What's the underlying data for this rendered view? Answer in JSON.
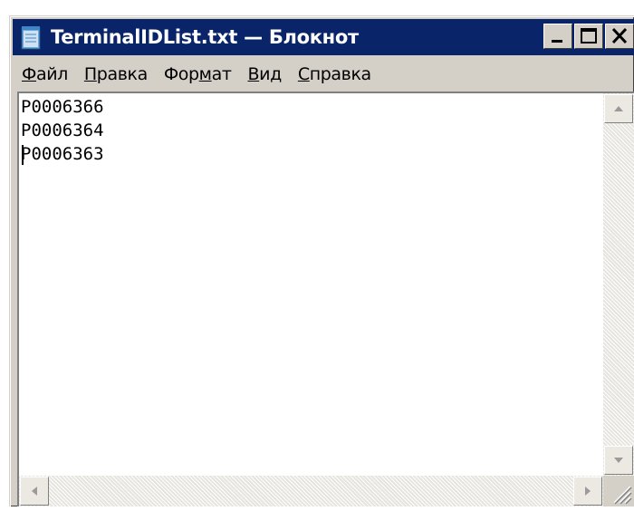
{
  "window": {
    "title": "TerminalIDList.txt — Блокнот"
  },
  "menu": {
    "file": {
      "accel": "Ф",
      "rest": "айл"
    },
    "edit": {
      "accel": "П",
      "rest": "равка"
    },
    "format": {
      "pre": "Фор",
      "accel": "м",
      "post": "ат"
    },
    "view": {
      "accel": "В",
      "rest": "ид"
    },
    "help": {
      "accel": "С",
      "rest": "правка"
    }
  },
  "document": {
    "lines": [
      "P0006366",
      "P0006364",
      "P0006363"
    ]
  },
  "colors": {
    "titlebar": "#0a246a",
    "face": "#d4d0c8",
    "text": "#000000"
  },
  "icons": {
    "app": "notepad-icon",
    "minimize": "minimize-icon",
    "maximize": "maximize-icon",
    "close": "close-icon"
  }
}
